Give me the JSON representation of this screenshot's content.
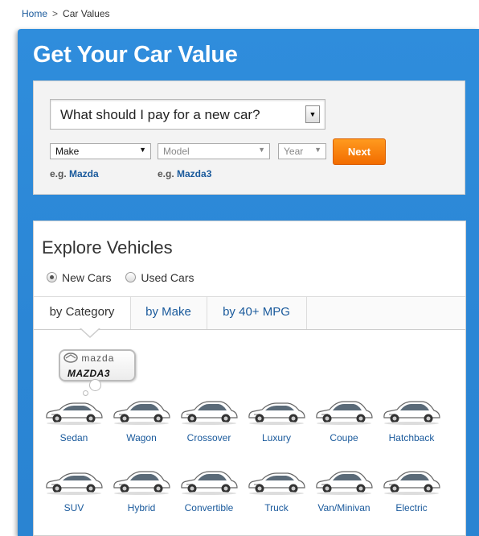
{
  "breadcrumb": {
    "home": "Home",
    "separator": ">",
    "current": "Car Values"
  },
  "header": {
    "title": "Get Your Car Value"
  },
  "value_form": {
    "question_select": "What should I pay for a new car?",
    "make_select": "Make",
    "model_select": "Model",
    "year_select": "Year",
    "next_button": "Next",
    "eg_prefix": "e.g.",
    "eg_make": "Mazda",
    "eg_model": "Mazda3"
  },
  "explore": {
    "title": "Explore Vehicles",
    "radios": [
      {
        "label": "New Cars",
        "checked": true
      },
      {
        "label": "Used Cars",
        "checked": false
      }
    ],
    "tabs": [
      "by Category",
      "by Make",
      "by 40+ MPG"
    ],
    "featured": {
      "brand": "mazda",
      "model": "MAZDA3"
    },
    "categories": [
      "Sedan",
      "Wagon",
      "Crossover",
      "Luxury",
      "Coupe",
      "Hatchback",
      "SUV",
      "Hybrid",
      "Convertible",
      "Truck",
      "Van/Minivan",
      "Electric"
    ]
  },
  "colors": {
    "accent_blue": "#2b86d5",
    "link_blue": "#1a5a9c",
    "button_orange": "#f57a00"
  }
}
